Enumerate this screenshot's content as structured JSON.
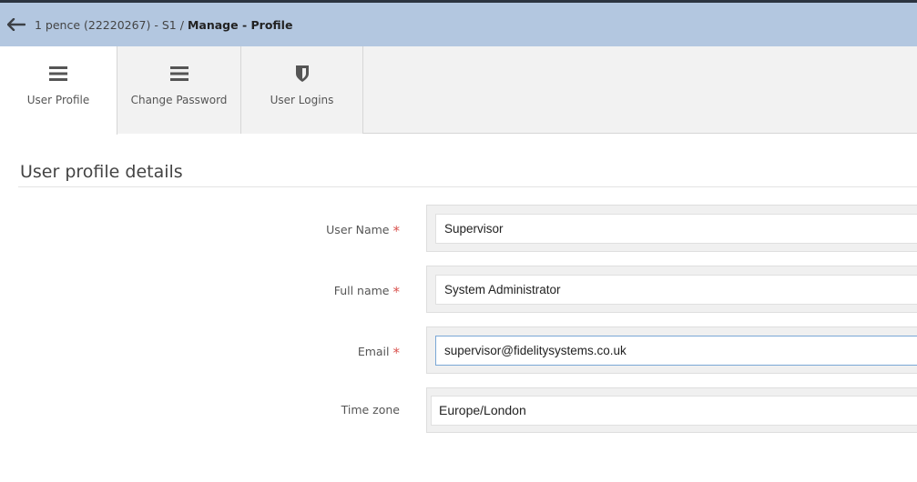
{
  "header": {
    "breadcrumb_parent": "1 pence (22220267) - S1",
    "separator": "/",
    "current_section": "Manage",
    "current_sep": " - ",
    "current_page": "Profile"
  },
  "tabs": [
    {
      "label": "User Profile",
      "icon": "hamburger-menu-icon",
      "active": true
    },
    {
      "label": "Change Password",
      "icon": "hamburger-menu-icon",
      "active": false
    },
    {
      "label": "User Logins",
      "icon": "shield-icon",
      "active": false
    }
  ],
  "section": {
    "title": "User profile details"
  },
  "form": {
    "required_marker": "*",
    "username": {
      "label": "User Name",
      "value": "Supervisor"
    },
    "fullname": {
      "label": "Full name",
      "value": "System Administrator"
    },
    "email": {
      "label": "Email",
      "value": "supervisor@fidelitysystems.co.uk"
    },
    "timezone": {
      "label": "Time zone",
      "value": "Europe/London"
    }
  },
  "colors": {
    "header_bg": "#b3c7e0",
    "required": "#d9534f",
    "focus_border": "#7aa7d6"
  }
}
